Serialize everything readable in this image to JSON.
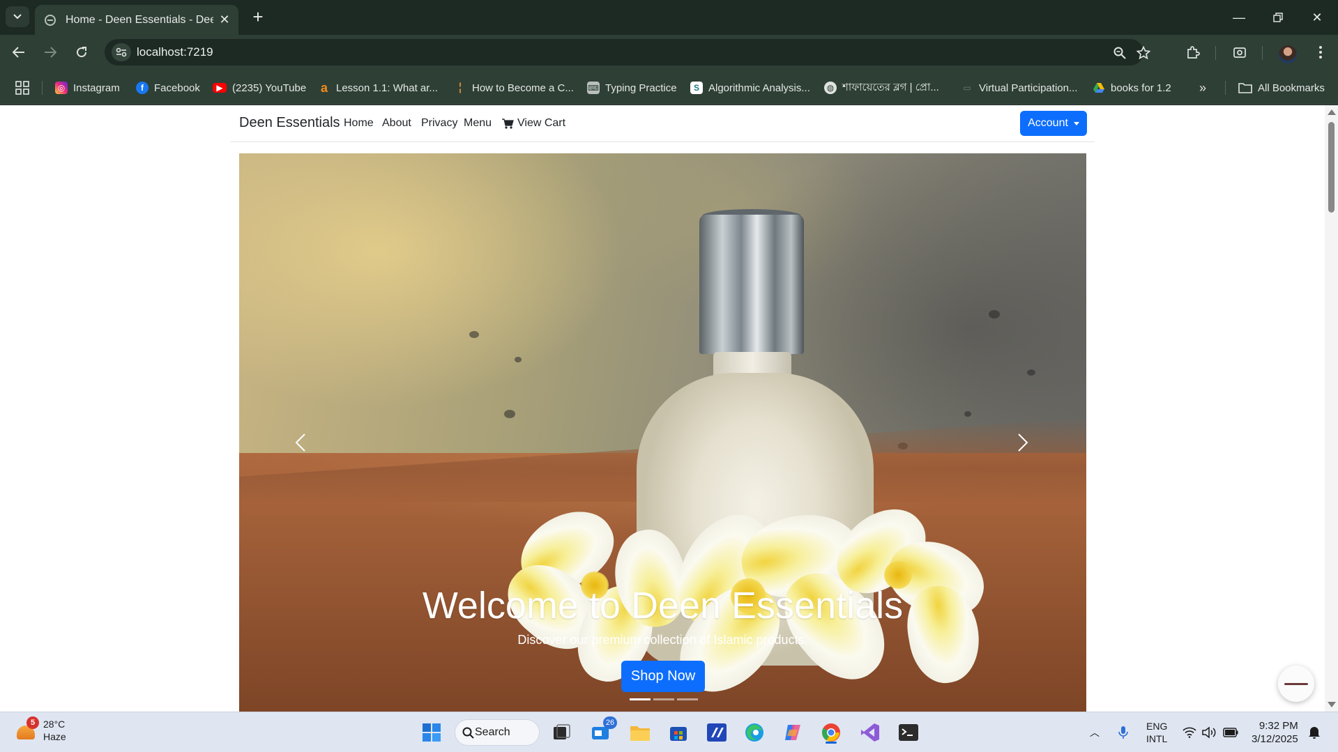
{
  "browser": {
    "tab_title": "Home - Deen Essentials - Deen",
    "url": "localhost:7219",
    "bookmarks": [
      {
        "label": "Instagram",
        "icon": "instagram-icon",
        "color": "#e1306c"
      },
      {
        "label": "Facebook",
        "icon": "facebook-icon",
        "color": "#1877f2"
      },
      {
        "label": "(2235) YouTube",
        "icon": "youtube-icon",
        "color": "#ff0000"
      },
      {
        "label": "Lesson 1.1: What ar...",
        "icon": "lesson-icon",
        "color": "#f28c1b"
      },
      {
        "label": "How to Become a C...",
        "icon": "article-icon",
        "color": "#c98a3a"
      },
      {
        "label": "Typing Practice",
        "icon": "typing-icon",
        "color": "#9aa3a0"
      },
      {
        "label": "Algorithmic Analysis...",
        "icon": "scribd-icon",
        "color": "#1e7b85"
      },
      {
        "label": "শাফায়েতের ব্লগ | প্রো...",
        "icon": "globe-icon",
        "color": "#9aa3a0"
      },
      {
        "label": "Virtual Participation...",
        "icon": "codeforces-icon",
        "color": "#3b5998"
      },
      {
        "label": "books for 1.2",
        "icon": "drive-icon",
        "color": "#34a853"
      }
    ],
    "all_bookmarks_label": "All Bookmarks"
  },
  "site": {
    "brand": "Deen Essentials",
    "nav": [
      "Home",
      "About",
      "Privacy",
      "Menu"
    ],
    "cart_label": "View Cart",
    "account_label": "Account"
  },
  "hero": {
    "title": "Welcome to Deen Essentials",
    "subtitle": "Discover our premium collection of Islamic products.",
    "cta": "Shop Now",
    "slide_count": 3,
    "active_slide": 1
  },
  "taskbar": {
    "weather_temp": "28°C",
    "weather_desc": "Haze",
    "weather_badge": "5",
    "search_label": "Search",
    "store_badge": "26",
    "lang_line1": "ENG",
    "lang_line2": "INTL",
    "time": "9:32 PM",
    "date": "3/12/2025"
  },
  "colors": {
    "primary": "#0d6efd",
    "chrome_bg": "#2e3f36"
  }
}
